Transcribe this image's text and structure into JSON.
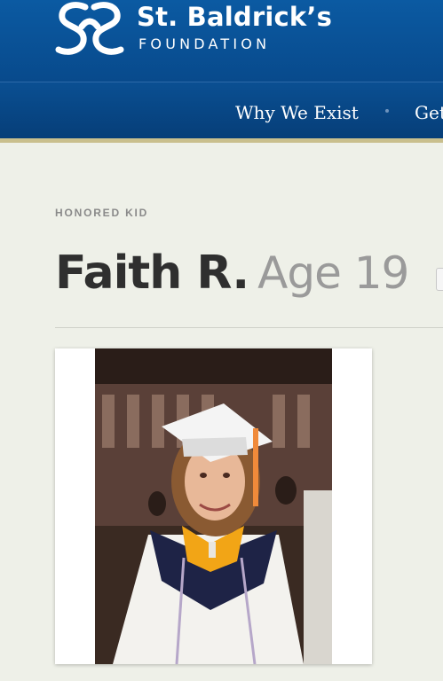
{
  "brand": {
    "name": "St. Baldrick’s",
    "subtitle": "FOUNDATION",
    "logo_icon": "sb-logo-mark"
  },
  "nav": {
    "items": [
      {
        "label": "Why We Exist"
      },
      {
        "label": "Get"
      }
    ]
  },
  "profile": {
    "eyebrow": "HONORED KID",
    "name": "Faith R.",
    "age": "Age 19",
    "photo_icon": "graduation-photo"
  },
  "colors": {
    "header_blue": "#0b5aa2",
    "nav_blue": "#084a8c",
    "accent_tan": "#c9bf8d",
    "page_bg": "#eef0e8",
    "name_text": "#2f2f2f",
    "age_text": "#9a9a9a"
  }
}
